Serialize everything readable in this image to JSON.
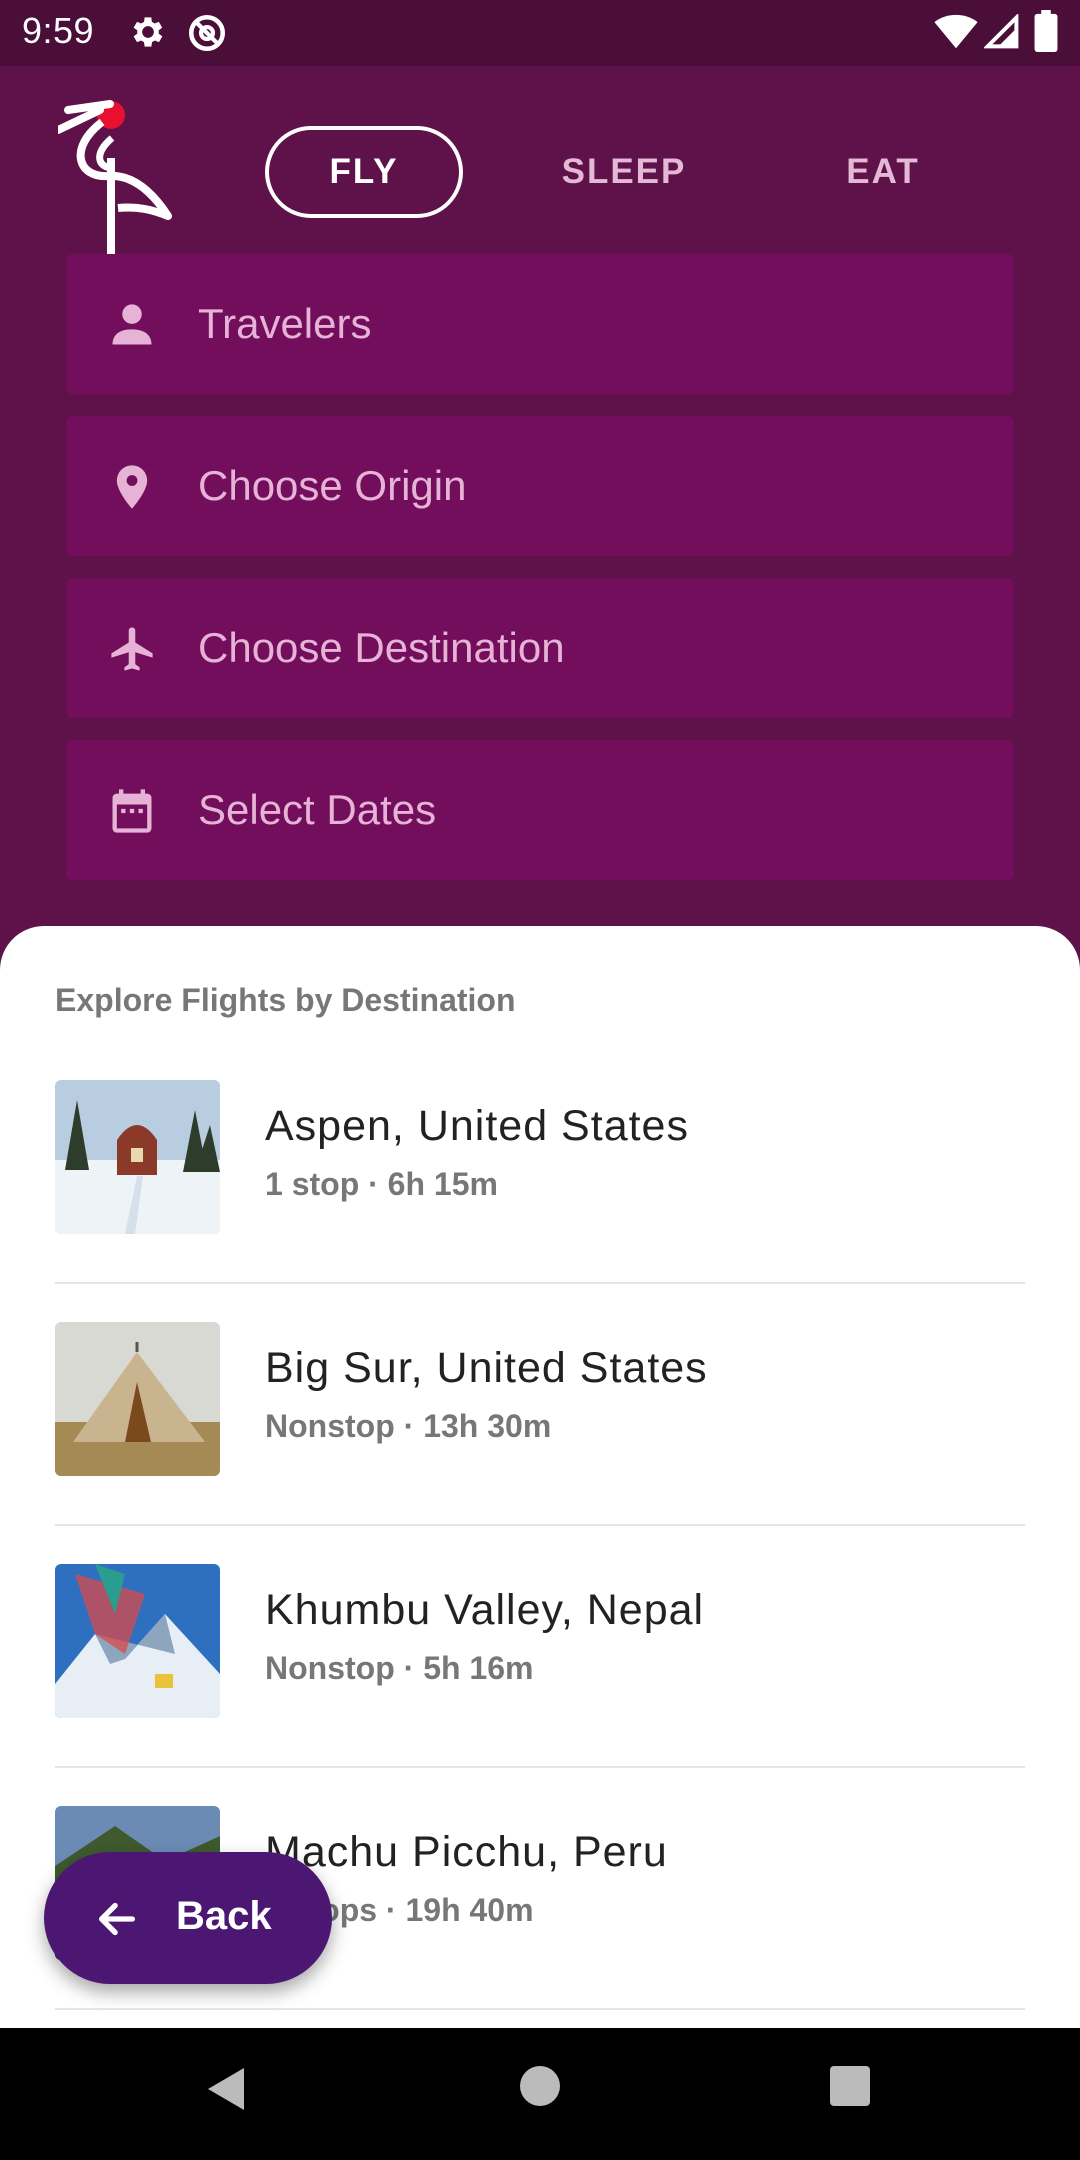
{
  "status_bar": {
    "time": "9:59",
    "icons": [
      "settings-icon",
      "at-sign-icon",
      "wifi-icon",
      "signal-icon",
      "battery-icon"
    ]
  },
  "header": {
    "logo": "crane-logo",
    "tabs": [
      {
        "label": "FLY",
        "active": true
      },
      {
        "label": "SLEEP",
        "active": false
      },
      {
        "label": "EAT",
        "active": false
      }
    ]
  },
  "form": {
    "travelers": {
      "placeholder": "Travelers",
      "icon": "person-icon"
    },
    "origin": {
      "placeholder": "Choose Origin",
      "icon": "location-pin-icon"
    },
    "destination": {
      "placeholder": "Choose Destination",
      "icon": "airplane-icon"
    },
    "dates": {
      "placeholder": "Select Dates",
      "icon": "calendar-icon"
    }
  },
  "explore": {
    "title": "Explore Flights by Destination",
    "items": [
      {
        "title": "Aspen, United States",
        "subtitle": "1 stop · 6h 15m"
      },
      {
        "title": "Big Sur, United States",
        "subtitle": "Nonstop · 13h 30m"
      },
      {
        "title": "Khumbu Valley, Nepal",
        "subtitle": "Nonstop · 5h 16m"
      },
      {
        "title": "Machu Picchu, Peru",
        "subtitle": "2 stops · 19h 40m"
      }
    ]
  },
  "back_button": {
    "label": "Back",
    "icon": "arrow-back-icon"
  },
  "nav_bar": [
    "back-triangle-icon",
    "home-circle-icon",
    "recents-square-icon"
  ],
  "colors": {
    "primary": "#5e1249",
    "field": "#720e5b",
    "status_bar": "#4a0e38",
    "accent_red": "#e8102e",
    "fab": "#4b1772"
  }
}
